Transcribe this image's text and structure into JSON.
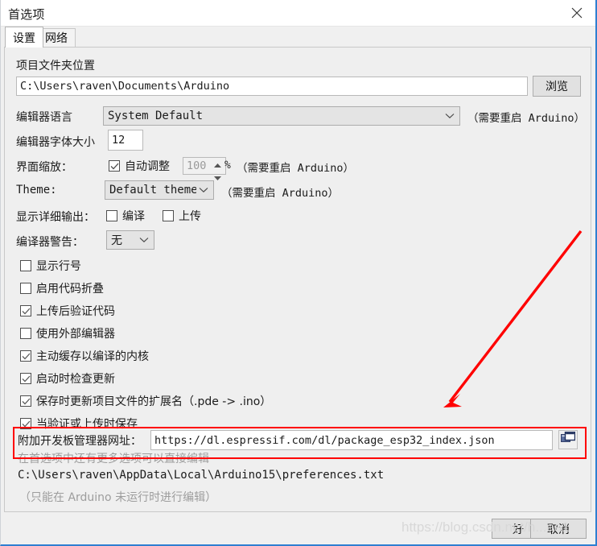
{
  "window": {
    "title": "首选项",
    "close_icon": "close-icon"
  },
  "tabs": [
    {
      "label": "设置",
      "active": true
    },
    {
      "label": "网络",
      "active": false
    }
  ],
  "settings": {
    "sketchbook": {
      "label": "项目文件夹位置",
      "value": "C:\\Users\\raven\\Documents\\Arduino",
      "browse_label": "浏览"
    },
    "language": {
      "label": "编辑器语言",
      "value": "System Default",
      "note": "（需要重启 Arduino）"
    },
    "font_size": {
      "label": "编辑器字体大小",
      "value": "12"
    },
    "ui_scale": {
      "label": "界面缩放：",
      "auto_label": "自动调整",
      "auto_checked": true,
      "percent_value": "100",
      "percent_symbol": "%",
      "note": "（需要重启 Arduino）"
    },
    "theme": {
      "label": "Theme:",
      "value": "Default theme",
      "note": "（需要重启 Arduino）"
    },
    "verbose": {
      "label": "显示详细输出：",
      "compile_label": "编译",
      "compile_checked": false,
      "upload_label": "上传",
      "upload_checked": false
    },
    "warnings": {
      "label": "编译器警告：",
      "value": "无"
    },
    "checkboxes": [
      {
        "label": "显示行号",
        "checked": false
      },
      {
        "label": "启用代码折叠",
        "checked": false
      },
      {
        "label": "上传后验证代码",
        "checked": true
      },
      {
        "label": "使用外部编辑器",
        "checked": false
      },
      {
        "label": "主动缓存以编译的内核",
        "checked": true
      },
      {
        "label": "启动时检查更新",
        "checked": true
      },
      {
        "label": "保存时更新项目文件的扩展名（.pde -> .ino）",
        "checked": true
      },
      {
        "label": "当验证或上传时保存",
        "checked": true
      }
    ],
    "board_manager_urls": {
      "label": "附加开发板管理器网址：",
      "value": "https://dl.espressif.com/dl/package_esp32_index.json",
      "icon": "window-copy-icon"
    },
    "more_prefs_note": "在首选项中还有更多选项可以直接编辑",
    "prefs_path": "C:\\Users\\raven\\AppData\\Local\\Arduino15\\preferences.txt",
    "prefs_hint": "（只能在 Arduino 未运行时进行编辑）"
  },
  "footer": {
    "ok_label": "好",
    "cancel_label": "取消",
    "watermark": "https://blog.csdn.net/h...aa1"
  },
  "annotations": {
    "highlight_color": "#ff0000",
    "arrow_color": "#ff0000"
  }
}
